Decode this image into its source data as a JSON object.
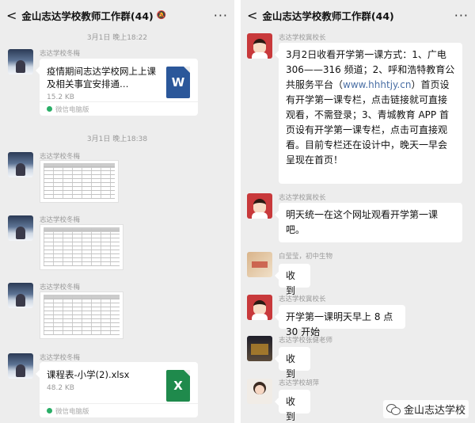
{
  "left": {
    "header": {
      "back": "<",
      "title": "金山志达学校教师工作群(44)",
      "more": "···"
    },
    "timestamps": [
      "3月1日 晚上18:22",
      "3月1日 晚上18:38"
    ],
    "sender": "志达学校冬梅",
    "file1": {
      "title": "疫情期间志达学校网上上课及相关事宜安排通…",
      "size": "15.2 KB",
      "source": "微信电脑版",
      "icon": "W"
    },
    "file2": {
      "title": "课程表-小学(2).xlsx",
      "size": "48.2 KB",
      "source": "微信电脑版",
      "icon": "X"
    }
  },
  "right": {
    "header": {
      "back": "<",
      "title": "金山志达学校教师工作群(44)",
      "more": "···"
    },
    "messages": [
      {
        "sender": "志达学校冀校长",
        "text_a": "3月2日收看开学第一课方式：1、广电 306——316 频道；2、呼和浩特教育公共服务平台（",
        "link": "www.hhhtjy.cn",
        "text_b": "）首页设有开学第一课专栏，点击链接就可直接观看，不需登录；3、青城教育 APP 首页设有开学第一课专栏，点击可直接观看。目前专栏还在设计中，晚天一早会呈现在首页！"
      },
      {
        "sender": "志达学校冀校长",
        "text": "明天统一在这个网址观看开学第一课吧。"
      },
      {
        "sender": "白莹莹，初中生物",
        "text": "收到"
      },
      {
        "sender": "志达学校冀校长",
        "text": "开学第一课明天早上 8 点 30 开始"
      },
      {
        "sender": "志达学校张健老师",
        "text": "收到"
      },
      {
        "sender": "志达学校胡萍",
        "text": "收到"
      }
    ],
    "watermark": "金山志达学校"
  }
}
